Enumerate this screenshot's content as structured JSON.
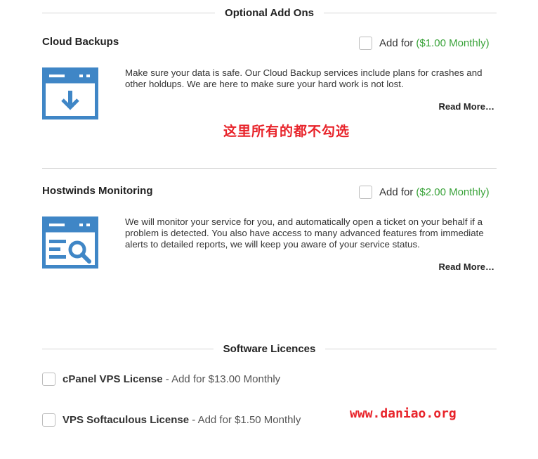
{
  "optional_addons": {
    "title": "Optional Add Ons",
    "items": [
      {
        "name": "Cloud Backups",
        "add_for": "Add for",
        "price": "($1.00 Monthly)",
        "checked": false,
        "icon": "download-window-icon",
        "description": "Make sure your data is safe. Our Cloud Backup services include plans for crashes and other holdups. We are here to make sure your hard work is not lost.",
        "read_more": "Read More…"
      },
      {
        "name": "Hostwinds Monitoring",
        "add_for": "Add for",
        "price": "($2.00 Monthly)",
        "checked": false,
        "icon": "monitor-search-window-icon",
        "description": "We will monitor your service for you, and automatically open a ticket on your behalf if a problem is detected. You also have access to many advanced features from immediate alerts to detailed reports, we will keep you aware of your service status.",
        "read_more": "Read More…"
      }
    ]
  },
  "annotation_note": "这里所有的都不勾选",
  "software_licences": {
    "title": "Software Licences",
    "items": [
      {
        "name": "cPanel VPS License",
        "suffix": " - Add for $13.00 Monthly",
        "checked": false
      },
      {
        "name": "VPS Softaculous License",
        "suffix": " - Add for $1.50 Monthly",
        "checked": false
      }
    ]
  },
  "watermark": "www.daniao.org",
  "colors": {
    "icon_blue": "#3f86c6",
    "price_green": "#3aa33a",
    "annotation_red": "#e8232a",
    "divider": "#d6d6d6"
  }
}
